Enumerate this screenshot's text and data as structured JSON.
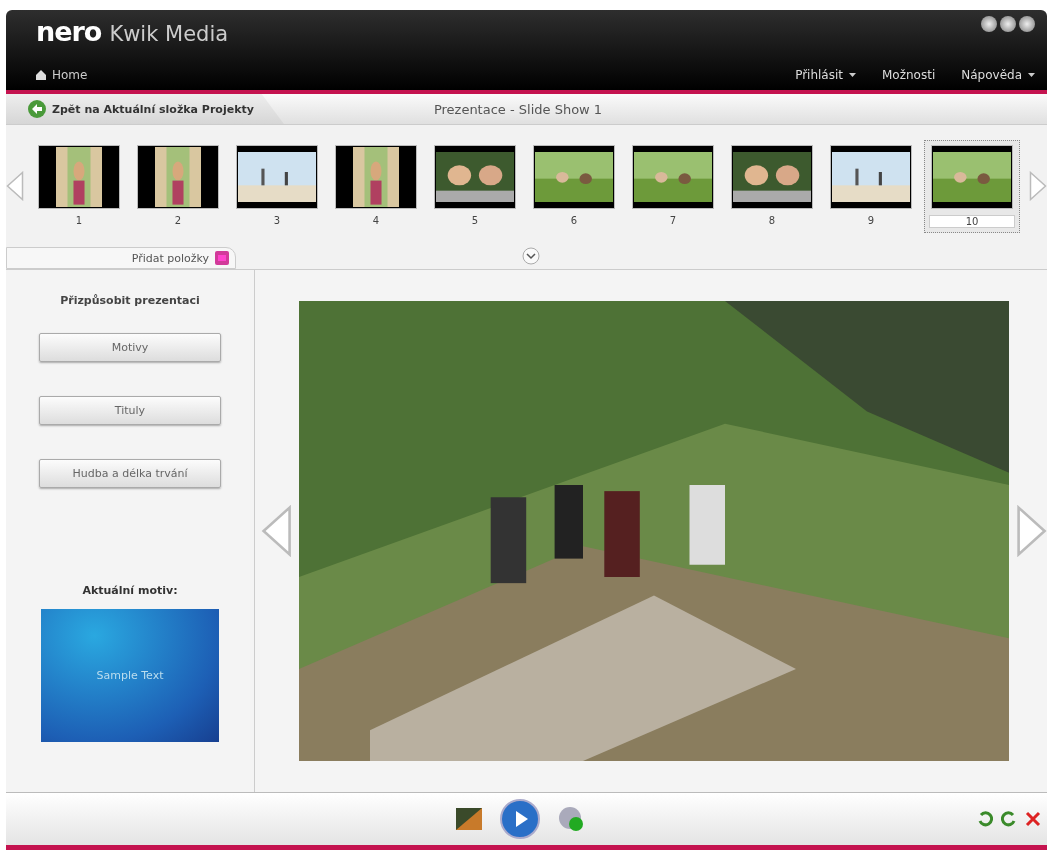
{
  "window": {
    "brand": "nero",
    "title": "Kwik Media",
    "home": "Home"
  },
  "menu": [
    {
      "label": "Přihlásit",
      "dropdown": true
    },
    {
      "label": "Možnosti",
      "dropdown": false
    },
    {
      "label": "Nápověda",
      "dropdown": true
    }
  ],
  "breadcrumb": {
    "back": "Zpět na Aktuální složka Projekty",
    "title": "Prezentace - Slide Show 1"
  },
  "slides": [
    {
      "number": "1",
      "kind": "portrait",
      "selected": false
    },
    {
      "number": "2",
      "kind": "portrait",
      "selected": false
    },
    {
      "number": "3",
      "kind": "beach",
      "selected": false
    },
    {
      "number": "4",
      "kind": "portrait",
      "selected": false
    },
    {
      "number": "5",
      "kind": "people",
      "selected": false
    },
    {
      "number": "6",
      "kind": "meadow",
      "selected": false
    },
    {
      "number": "7",
      "kind": "meadow",
      "selected": false
    },
    {
      "number": "8",
      "kind": "people",
      "selected": false
    },
    {
      "number": "9",
      "kind": "beach",
      "selected": false
    },
    {
      "number": "10",
      "kind": "meadow",
      "selected": true
    }
  ],
  "add_tab": "Přidat položky",
  "panel": {
    "title": "Přizpůsobit prezentaci",
    "buttons": [
      "Motivy",
      "Tituly",
      "Hudba a délka trvání"
    ],
    "theme_label": "Aktuální motiv:",
    "theme_sample": "Sample Text"
  }
}
